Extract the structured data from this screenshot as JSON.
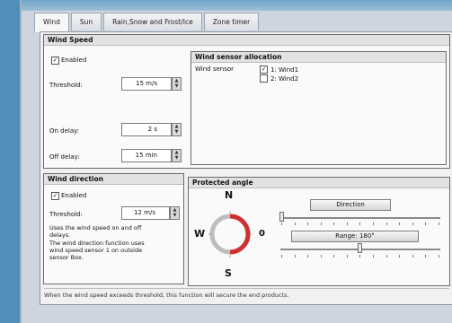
{
  "tabs": [
    "Wind",
    "Sun",
    "Rain,Snow and Frost/Ice",
    "Zone timer"
  ],
  "wind_speed": {
    "title": "Wind Speed",
    "enabled_label": "Enabled",
    "threshold_label": "Threshold:",
    "threshold_value": "15 m/s",
    "on_delay_label": "On delay:",
    "on_delay_value": "2 s",
    "off_delay_label": "Off delay:",
    "off_delay_value": "15 min"
  },
  "sensor_alloc": {
    "title": "Wind sensor allocation",
    "label": "Wind sensor",
    "sensors": [
      {
        "label": "1: Wind1",
        "checked": true
      },
      {
        "label": "2: Wind2",
        "checked": false
      }
    ]
  },
  "wind_direction": {
    "title": "Wind direction",
    "enabled_label": "Enabled",
    "threshold_label": "Threshold:",
    "threshold_value": "12 m/s",
    "note1": "Uses the wind speed on and off delays.",
    "note2": "The wind direction function uses wind speed sensor 1 on outside sensor Box."
  },
  "protected_angle": {
    "title": "Protected angle",
    "compass_n": "N",
    "compass_s": "S",
    "compass_w": "W",
    "compass_e": "0",
    "direction_button": "Direction",
    "range_button": "Range: 180°",
    "direction_value_fraction": 0.0,
    "range_value_fraction": 0.5
  },
  "status_text": "When the wind speed exceeds threshold, this function will secure the end products.",
  "colors": {
    "compass_red": "#d03030",
    "background_blue": "#4f8fb8"
  }
}
